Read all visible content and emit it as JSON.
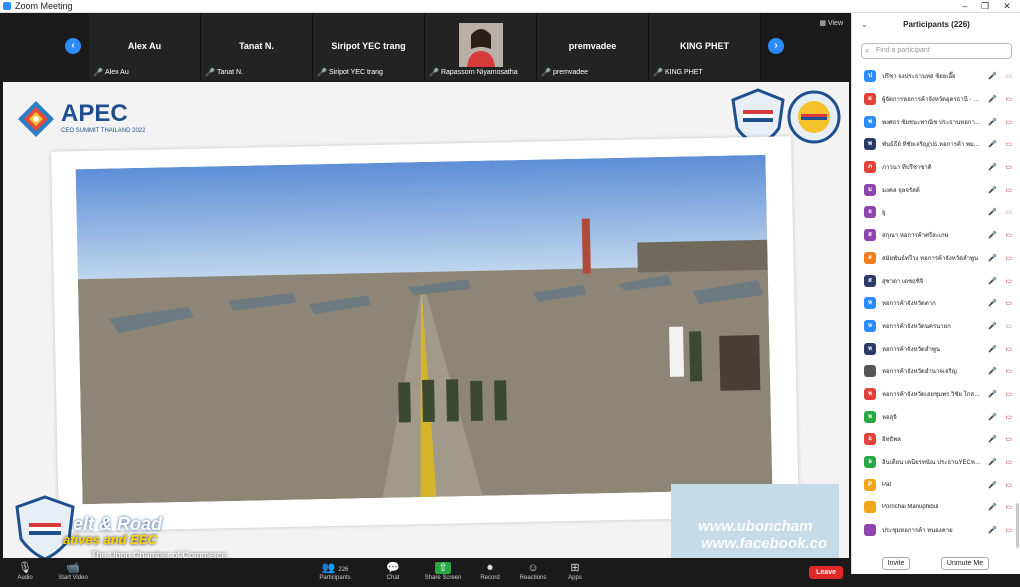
{
  "window": {
    "title": "Zoom Meeting",
    "minimize": "–",
    "restore": "❐",
    "close": "✕"
  },
  "strip": {
    "view_label": "View",
    "tiles": [
      {
        "name": "Alex Au",
        "label": "Alex Au"
      },
      {
        "name": "Tanat N.",
        "label": "Tanat N."
      },
      {
        "name": "Siripot YEC trang",
        "label": "Siripot YEC trang"
      },
      {
        "name": "",
        "label": "Rapassorn Niyamosatha"
      },
      {
        "name": "premvadee",
        "label": "premvadee"
      },
      {
        "name": "KING PHET",
        "label": "KING PHET"
      }
    ]
  },
  "slide": {
    "apec_title": "APEC",
    "apec_sub": "CEO SUMMIT THAILAND 2022",
    "banner_line1": "elt & Road",
    "banner_line2": "atives and EEC",
    "banner_line3": "The Ubon Chamber of Commerce",
    "watermark1": "www.uboncham",
    "watermark2": "www.facebook.co"
  },
  "toolbar": {
    "audio": "Audio",
    "start_video": "Start Video",
    "participants": "Participants",
    "participants_count": "226",
    "chat": "Chat",
    "share_screen": "Share Screen",
    "record": "Record",
    "reactions": "Reactions",
    "apps": "Apps",
    "leave": "Leave"
  },
  "panel": {
    "title": "Participants (226)",
    "search_placeholder": "Find a participant",
    "invite": "Invite",
    "unmute_me": "Unmute Me",
    "participants": [
      {
        "initial": "ป",
        "color": "#2d8cff",
        "name": "ปรีชา จงประธานหอ ช้อยเอี๊ย",
        "cam": "on"
      },
      {
        "initial": "ผ",
        "color": "#e0413a",
        "name": "ผู้จัดการหอการค้าจังหวัดอุดรธานี - มิ...",
        "cam": "off"
      },
      {
        "initial": "พ",
        "color": "#2d8cff",
        "name": "พงศธร ชัยชนะพาณิช ประธานหอการ...",
        "cam": "off"
      },
      {
        "initial": "พ",
        "color": "#2b3a67",
        "name": "พันธ์ธีย์ ทิชัยเจริญ(ปธ.หอการค้า พม...",
        "cam": "off"
      },
      {
        "initial": "ภ",
        "color": "#e0413a",
        "name": "ภาวนา ทีปรีชาชาติ",
        "cam": "off"
      },
      {
        "initial": "ม",
        "color": "#8e44ad",
        "name": "มงคล จุลจรัสด์",
        "cam": "off"
      },
      {
        "initial": "ย",
        "color": "#8e44ad",
        "name": "ยู",
        "cam": "on"
      },
      {
        "initial": "ส",
        "color": "#8e44ad",
        "name": "สกุณา หอการค้าศรีสะเกษ",
        "cam": "off"
      },
      {
        "initial": "ส",
        "color": "#f07c1b",
        "name": "สมัยพันธ์ทวีวง หอการค้าจังหวัดลำพูน",
        "cam": "off"
      },
      {
        "initial": "ส",
        "color": "#2b3a67",
        "name": "สุชาดา เดชฤชิจิ",
        "cam": "off"
      },
      {
        "initial": "ห",
        "color": "#2d8cff",
        "name": "หอการค้าจังหวัดตาก",
        "cam": "off"
      },
      {
        "initial": "ห",
        "color": "#2d8cff",
        "name": "หอการค้าจังหวัดนครนายก",
        "cam": "on"
      },
      {
        "initial": "ห",
        "color": "#2b3a67",
        "name": "หอการค้าจังหวัดลำพูน",
        "cam": "off"
      },
      {
        "initial": "",
        "color": "#555555",
        "name": "หอการค้าจังหวัดอำนาจเจริญ",
        "cam": "off"
      },
      {
        "initial": "ห",
        "color": "#e0413a",
        "name": "หอการค้าจังหวัดเลยชุมพร วิชัย โกสมนิก",
        "cam": "off"
      },
      {
        "initial": "ห",
        "color": "#27a844",
        "name": "หอสุจิ",
        "cam": "off"
      },
      {
        "initial": "อ",
        "color": "#e0413a",
        "name": "อิทธิพล",
        "cam": "off"
      },
      {
        "initial": "อ",
        "color": "#27a844",
        "name": "อินเตียน เคนียรทนัณ ประธานYECหอ...",
        "cam": "off"
      },
      {
        "initial": "P",
        "color": "#f0a51b",
        "name": "Pat",
        "cam": "off"
      },
      {
        "initial": "",
        "color": "#f0a51b",
        "name": "Pornchai Manuphibul",
        "cam": "off"
      },
      {
        "initial": "",
        "color": "#8e44ad",
        "name": "ประชุมหอการค้า หนองคาย",
        "cam": "off"
      }
    ]
  }
}
